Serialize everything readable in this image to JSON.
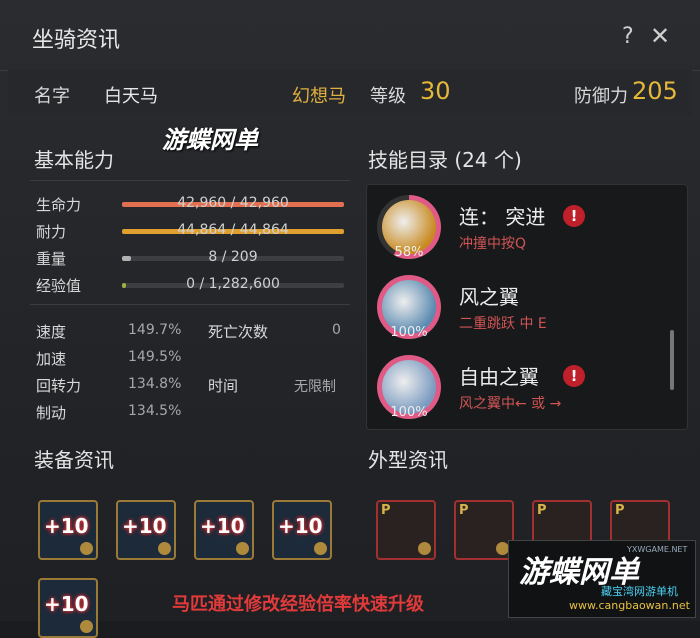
{
  "window": {
    "title": "坐骑资讯",
    "help": "?",
    "close": "✕"
  },
  "info": {
    "name_label": "名字",
    "name_value": "白天马",
    "type": "幻想马",
    "level_label": "等级",
    "level_value": "30",
    "defense_label": "防御力",
    "defense_value": "205"
  },
  "overlay_caption": "游蝶网单",
  "basic": {
    "title": "基本能力",
    "bars": [
      {
        "label": "生命力",
        "text": "42,960 / 42,960",
        "fraction": 1.0,
        "color": "#e07050"
      },
      {
        "label": "耐力",
        "text": "44,864 / 44,864",
        "fraction": 1.0,
        "color": "#e0a030"
      },
      {
        "label": "重量",
        "text": "8 / 209",
        "fraction": 0.04,
        "color": "#b0b0b0"
      },
      {
        "label": "经验值",
        "text": "0 / 1,282,600",
        "fraction": 0.0,
        "color": "#a0b040"
      }
    ],
    "stats": [
      {
        "label": "速度",
        "value": "149.7%"
      },
      {
        "label": "加速",
        "value": "149.5%"
      },
      {
        "label": "回转力",
        "value": "134.8%"
      },
      {
        "label": "制动",
        "value": "134.5%"
      }
    ],
    "deaths_label": "死亡次数",
    "deaths_value": "0",
    "time_label": "时间",
    "time_value": "无限制"
  },
  "skills": {
    "title": "技能目录 (24 个)",
    "items": [
      {
        "name": "连： 突进",
        "desc": "冲撞中按Q",
        "pct": "58%",
        "fill": 0.58,
        "warn": true,
        "bg": "#c88a20"
      },
      {
        "name": "风之翼",
        "desc": "二重跳跃 中 E",
        "pct": "100%",
        "fill": 1.0,
        "warn": false,
        "bg": "#5a8ab0"
      },
      {
        "name": "自由之翼",
        "desc": "风之翼中← 或 →",
        "pct": "100%",
        "fill": 1.0,
        "warn": true,
        "bg": "#7a9ac0"
      }
    ],
    "warn_glyph": "!"
  },
  "equipment": {
    "title": "装备资讯",
    "slots": [
      "+10",
      "+10",
      "+10",
      "+10",
      "+10"
    ]
  },
  "appearance": {
    "title": "外型资讯",
    "slots": [
      "P",
      "P",
      "P",
      "P"
    ]
  },
  "caption": "马匹通过修改经验倍率快速升级",
  "logo": {
    "text": "游蝶网单",
    "sub": "藏宝湾网游单机",
    "url": "www.cangbaowan.net",
    "tiny": "YXWGAME.NET"
  }
}
